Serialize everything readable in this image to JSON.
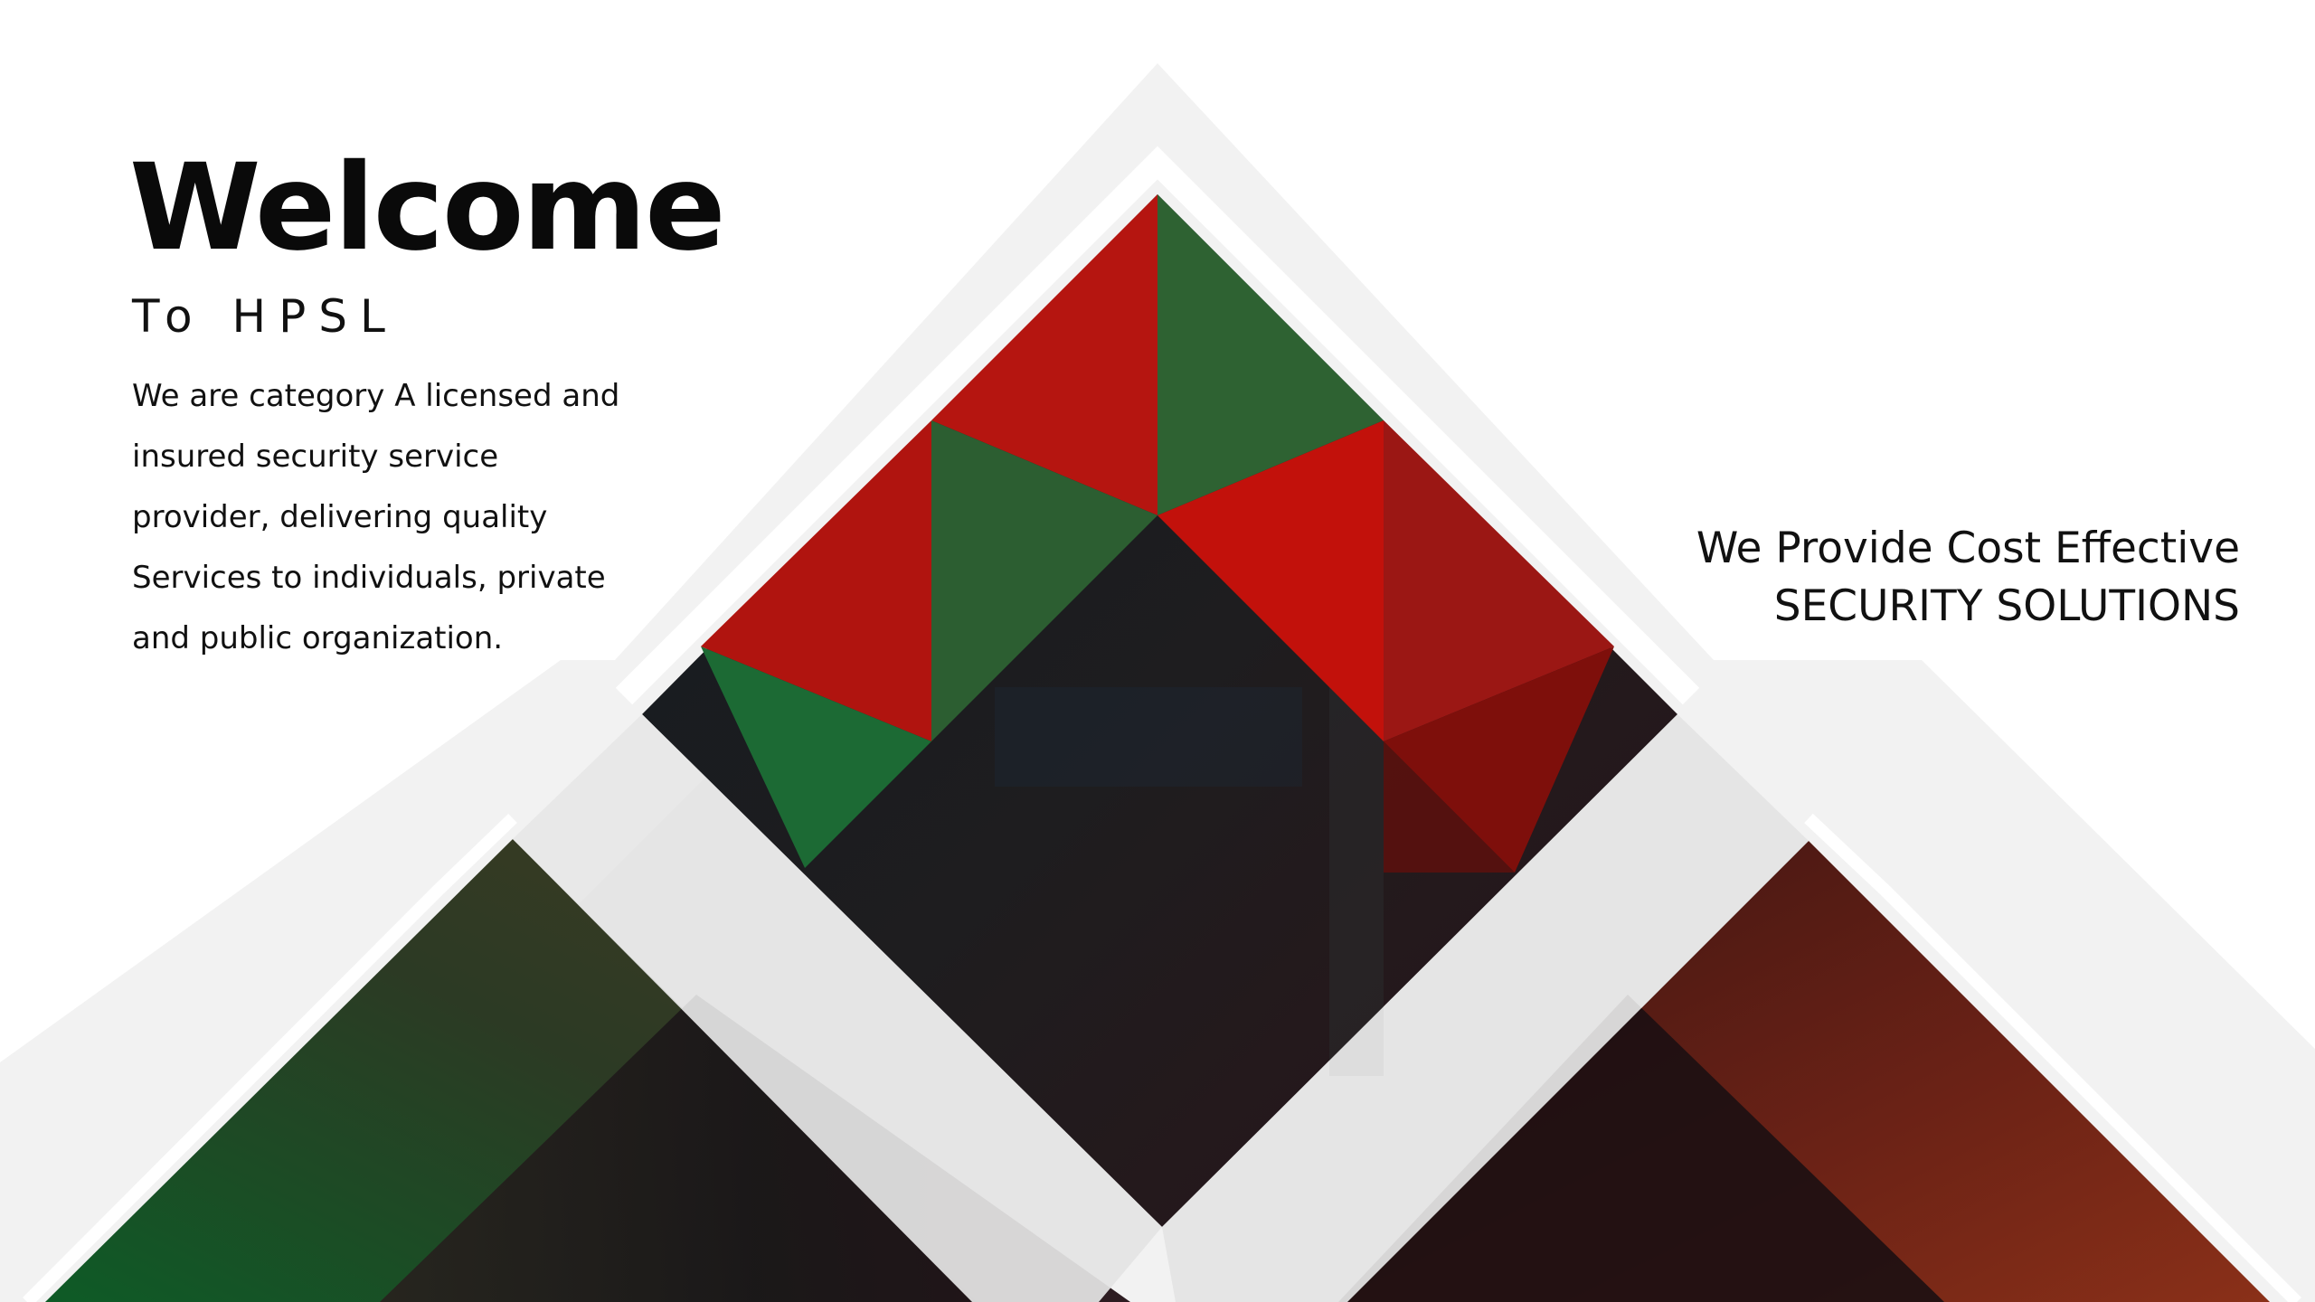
{
  "slide": {
    "heading": "Welcome",
    "subheading": "To HPSL",
    "description": "We are category A licensed and insured security service provider, delivering quality Services to individuals, private and public organization.",
    "tagline": {
      "line1": "We Provide Cost Effective",
      "line2": "SECURITY SOLUTIONS"
    }
  },
  "colors": {
    "brand_red": "#b51510",
    "brand_green": "#2d6230",
    "dark_overlay": "#161a1e",
    "band_gray": "#f1f1f1",
    "ribbon_gray": "#dedede"
  }
}
